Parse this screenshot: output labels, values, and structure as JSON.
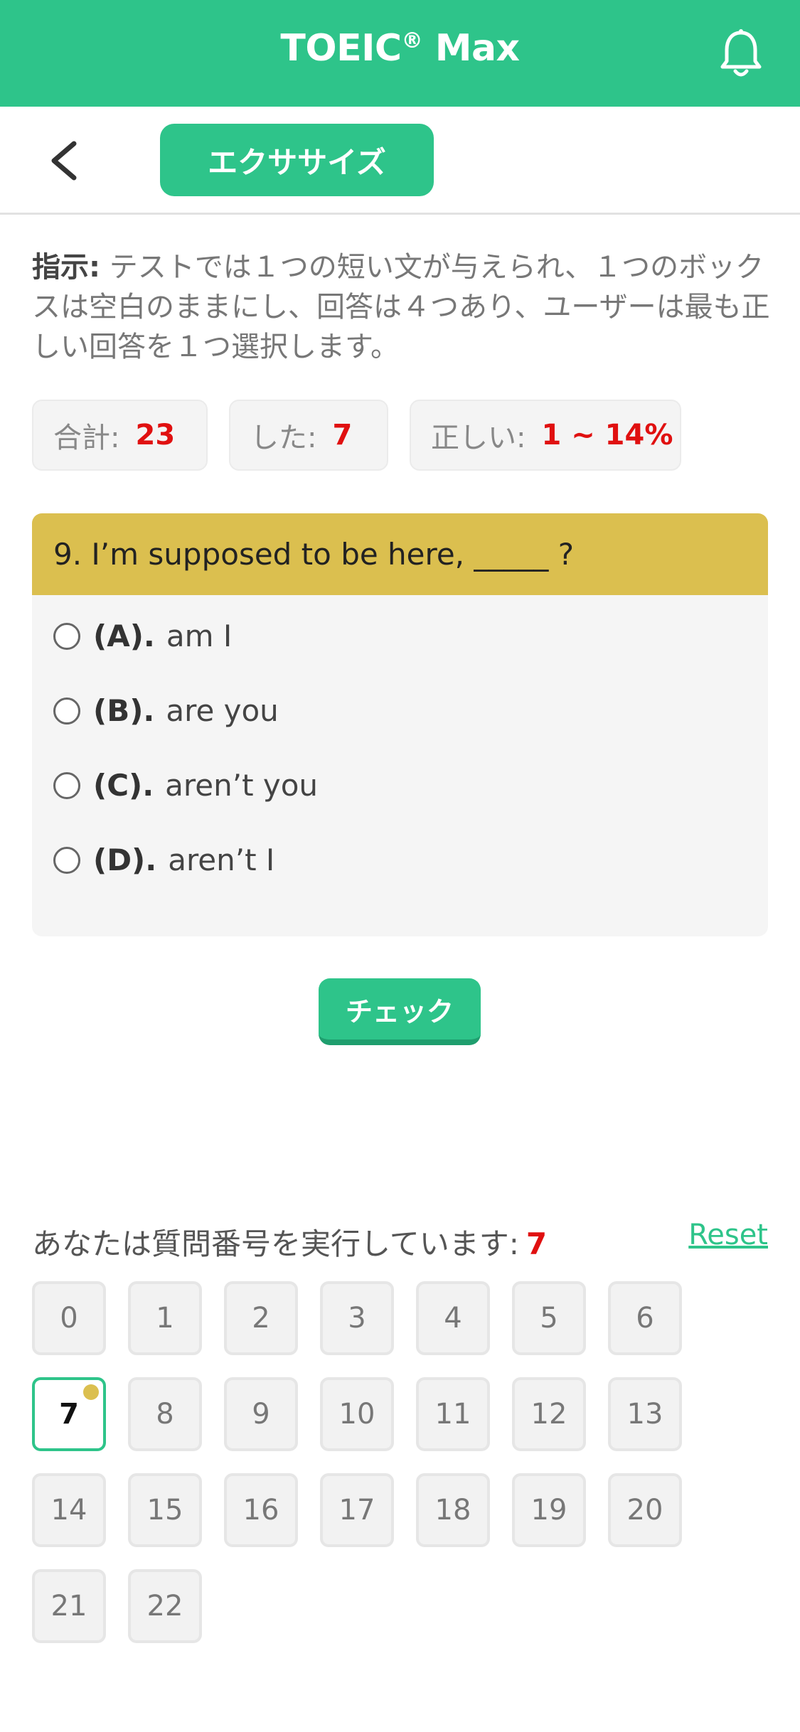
{
  "header": {
    "title": "TOEIC",
    "title_mark": "®",
    "title_suffix": " Max"
  },
  "subnav": {
    "tab_label": "エクササイズ"
  },
  "instructions": {
    "label": "指示:",
    "text": " テストでは１つの短い文が与えられ、１つのボックスは空白のままにし、回答は４つあり、ユーザーは最も正しい回答を１つ選択します。"
  },
  "stats": {
    "total_label": "合計:",
    "total_value": "23",
    "done_label": "した:",
    "done_value": "7",
    "correct_label": "正しい:",
    "correct_value": "1 ~ 14%"
  },
  "question": {
    "text": "9. I’m supposed to be here, _____ ?",
    "options": [
      {
        "key": "(A).",
        "text": "am I"
      },
      {
        "key": "(B).",
        "text": "are you"
      },
      {
        "key": "(C).",
        "text": "aren’t you"
      },
      {
        "key": "(D).",
        "text": "aren’t I"
      }
    ]
  },
  "check_button": "チェック",
  "progress": {
    "label": "あなたは質問番号を実行しています:",
    "current": "7",
    "reset_label": "Reset"
  },
  "question_numbers": [
    "0",
    "1",
    "2",
    "3",
    "4",
    "5",
    "6",
    "7",
    "8",
    "9",
    "10",
    "11",
    "12",
    "13",
    "14",
    "15",
    "16",
    "17",
    "18",
    "19",
    "20",
    "21",
    "22"
  ],
  "colors": {
    "brand": "#2ec48a",
    "question_header": "#dbbf4f",
    "highlight": "#e01010"
  }
}
